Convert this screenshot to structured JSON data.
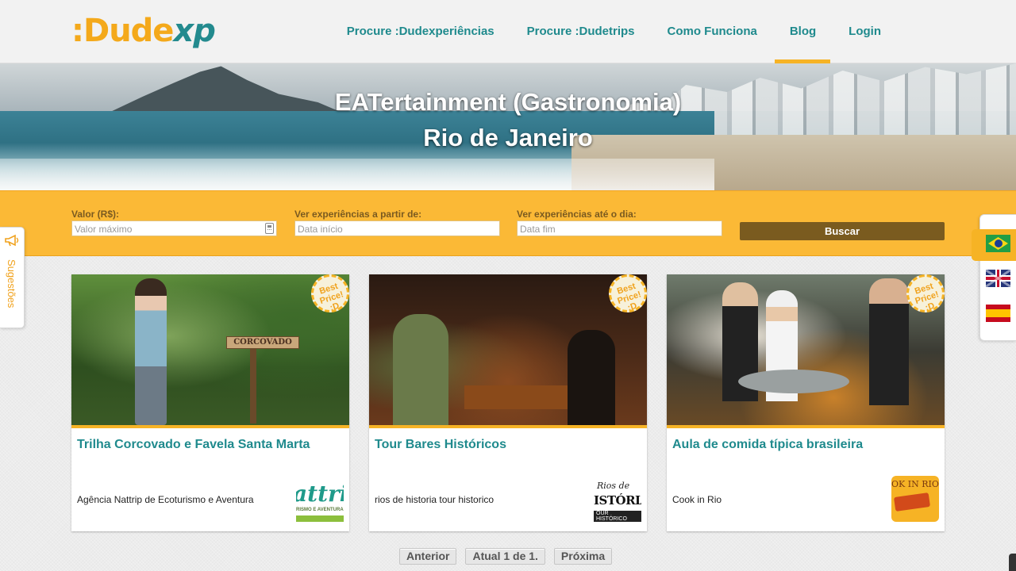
{
  "header": {
    "logo_prefix": ":Dude",
    "logo_suffix": "xp",
    "nav": [
      {
        "label": "Procure :Dudexperiências"
      },
      {
        "label": "Procure :Dudetrips"
      },
      {
        "label": "Como Funciona"
      },
      {
        "label": "Blog",
        "active": true
      },
      {
        "label": "Login"
      }
    ]
  },
  "hero": {
    "title_line1": "EATertainment (Gastronomia)",
    "title_line2": "Rio de Janeiro"
  },
  "filter": {
    "valor": {
      "label": "Valor (R$):",
      "placeholder": "Valor máximo"
    },
    "inicio": {
      "label": "Ver experiências a partir de:",
      "placeholder": "Data início"
    },
    "fim": {
      "label": "Ver experiências até o dia:",
      "placeholder": "Data fim"
    },
    "button": "Buscar"
  },
  "badge": {
    "line1": "Best",
    "line2": "Price!",
    "line3": ":D"
  },
  "cards": [
    {
      "title": "Trilha Corcovado e Favela Santa Marta",
      "provider": "Agência Nattrip de Ecoturismo e Aventura",
      "sign": "CORCOVADO",
      "logo_main": "attri",
      "logo_sub": "RISMO E AVENTURA"
    },
    {
      "title": "Tour Bares Históricos",
      "provider": "rios de historia tour historico",
      "logo_top": "Rios de",
      "logo_main": "ISTÓRIA",
      "logo_sub": "OUR HISTÓRICO"
    },
    {
      "title": "Aula de comida típica brasileira",
      "provider": "Cook in Rio",
      "logo_main": "OK IN RIO"
    }
  ],
  "pager": {
    "prev": "Anterior",
    "current": "Atual 1 de 1.",
    "next": "Próxima"
  },
  "side": {
    "suggestions": "Sugestões"
  },
  "colors": {
    "accent": "#f6b325",
    "teal": "#1f8a8d",
    "button": "#7a5b1f"
  }
}
